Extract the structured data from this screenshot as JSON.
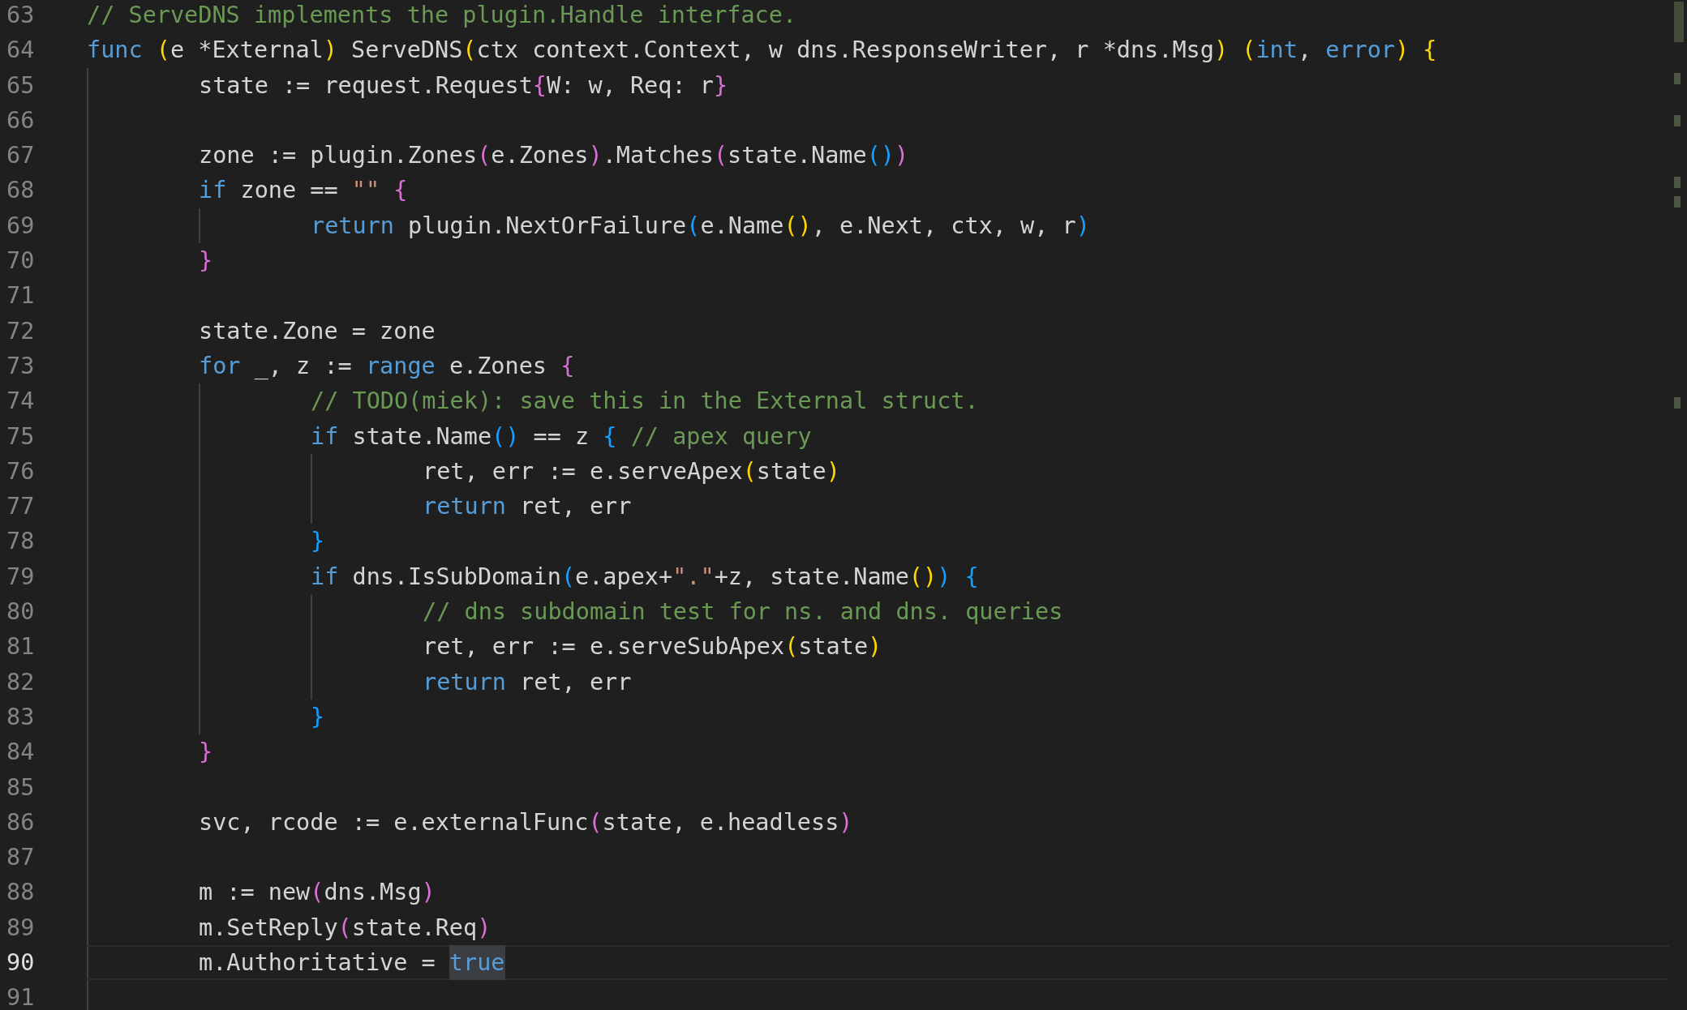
{
  "editor": {
    "lines": [
      {
        "number": "63",
        "current": false,
        "tokens": [
          {
            "text": "// ServeDNS implements the plugin.Handle interface.",
            "kind": "comment"
          }
        ]
      },
      {
        "number": "64",
        "current": false,
        "tokens": [
          {
            "text": "func",
            "kind": "keyword"
          },
          {
            "text": " (",
            "kind": "bracket1"
          },
          {
            "text": "e *External",
            "kind": "plain"
          },
          {
            "text": ")",
            "kind": "bracket1"
          },
          {
            "text": " ServeDNS",
            "kind": "plain"
          },
          {
            "text": "(",
            "kind": "bracket1"
          },
          {
            "text": "ctx context.Context, w dns.ResponseWriter, r *dns.Msg",
            "kind": "plain"
          },
          {
            "text": ")",
            "kind": "bracket1"
          },
          {
            "text": " (",
            "kind": "bracket1"
          },
          {
            "text": "int",
            "kind": "keyword"
          },
          {
            "text": ", ",
            "kind": "plain"
          },
          {
            "text": "error",
            "kind": "keyword"
          },
          {
            "text": ")",
            "kind": "bracket1"
          },
          {
            "text": " {",
            "kind": "bracket1"
          }
        ],
        "children": [
          {
            "number": "65",
            "current": false,
            "tokens": [
              {
                "text": "state := request.Request",
                "kind": "plain"
              },
              {
                "text": "{",
                "kind": "bracket2"
              },
              {
                "text": "W: w, Req: r",
                "kind": "plain"
              },
              {
                "text": "}",
                "kind": "bracket2"
              }
            ]
          },
          {
            "number": "66",
            "current": false
          },
          {
            "number": "67",
            "current": false,
            "tokens": [
              {
                "text": "zone := plugin.Zones",
                "kind": "plain"
              },
              {
                "text": "(",
                "kind": "bracket2"
              },
              {
                "text": "e.Zones",
                "kind": "plain"
              },
              {
                "text": ")",
                "kind": "bracket2"
              },
              {
                "text": ".Matches",
                "kind": "plain"
              },
              {
                "text": "(",
                "kind": "bracket2"
              },
              {
                "text": "state.Name",
                "kind": "plain"
              },
              {
                "text": "()",
                "kind": "bracket3"
              },
              {
                "text": ")",
                "kind": "bracket2"
              }
            ]
          },
          {
            "number": "68",
            "current": false,
            "tokens": [
              {
                "text": "if",
                "kind": "keyword"
              },
              {
                "text": " zone == ",
                "kind": "plain"
              },
              {
                "text": "\"\"",
                "kind": "string"
              },
              {
                "text": " {",
                "kind": "bracket2"
              }
            ],
            "children": [
              {
                "number": "69",
                "current": false,
                "tokens": [
                  {
                    "text": "return",
                    "kind": "keyword"
                  },
                  {
                    "text": " plugin.NextOrFailure",
                    "kind": "plain"
                  },
                  {
                    "text": "(",
                    "kind": "bracket3"
                  },
                  {
                    "text": "e.Name",
                    "kind": "plain"
                  },
                  {
                    "text": "()",
                    "kind": "bracket1"
                  },
                  {
                    "text": ", e.Next, ctx, w, r",
                    "kind": "plain"
                  },
                  {
                    "text": ")",
                    "kind": "bracket3"
                  }
                ]
              }
            ]
          },
          {
            "number": "70",
            "current": false,
            "tokens": [
              {
                "text": "}",
                "kind": "bracket2"
              }
            ]
          },
          {
            "number": "71",
            "current": false
          },
          {
            "number": "72",
            "current": false,
            "tokens": [
              {
                "text": "state.Zone = zone",
                "kind": "plain"
              }
            ]
          },
          {
            "number": "73",
            "current": false,
            "tokens": [
              {
                "text": "for",
                "kind": "keyword"
              },
              {
                "text": " _, z := ",
                "kind": "plain"
              },
              {
                "text": "range",
                "kind": "keyword"
              },
              {
                "text": " e.Zones",
                "kind": "plain"
              },
              {
                "text": " {",
                "kind": "bracket2"
              }
            ],
            "children": [
              {
                "number": "74",
                "current": false,
                "tokens": [
                  {
                    "text": "// TODO(miek): save this in the External struct.",
                    "kind": "comment"
                  }
                ]
              },
              {
                "number": "75",
                "current": false,
                "tokens": [
                  {
                    "text": "if",
                    "kind": "keyword"
                  },
                  {
                    "text": " state.Name",
                    "kind": "plain"
                  },
                  {
                    "text": "()",
                    "kind": "bracket3"
                  },
                  {
                    "text": " == z ",
                    "kind": "plain"
                  },
                  {
                    "text": "{",
                    "kind": "bracket3"
                  },
                  {
                    "text": " // apex query",
                    "kind": "comment"
                  }
                ],
                "children": [
                  {
                    "number": "76",
                    "current": false,
                    "tokens": [
                      {
                        "text": "ret, err := e.serveApex",
                        "kind": "plain"
                      },
                      {
                        "text": "(",
                        "kind": "bracket1"
                      },
                      {
                        "text": "state",
                        "kind": "plain"
                      },
                      {
                        "text": ")",
                        "kind": "bracket1"
                      }
                    ]
                  },
                  {
                    "number": "77",
                    "current": false,
                    "tokens": [
                      {
                        "text": "return",
                        "kind": "keyword"
                      },
                      {
                        "text": " ret, err",
                        "kind": "plain"
                      }
                    ]
                  }
                ]
              },
              {
                "number": "78",
                "current": false,
                "tokens": [
                  {
                    "text": "}",
                    "kind": "bracket3"
                  }
                ]
              },
              {
                "number": "79",
                "current": false,
                "tokens": [
                  {
                    "text": "if",
                    "kind": "keyword"
                  },
                  {
                    "text": " dns.IsSubDomain",
                    "kind": "plain"
                  },
                  {
                    "text": "(",
                    "kind": "bracket3"
                  },
                  {
                    "text": "e.apex+",
                    "kind": "plain"
                  },
                  {
                    "text": "\".\"",
                    "kind": "string"
                  },
                  {
                    "text": "+z, state.Name",
                    "kind": "plain"
                  },
                  {
                    "text": "()",
                    "kind": "bracket1"
                  },
                  {
                    "text": ")",
                    "kind": "bracket3"
                  },
                  {
                    "text": " {",
                    "kind": "bracket3"
                  }
                ],
                "children": [
                  {
                    "number": "80",
                    "current": false,
                    "tokens": [
                      {
                        "text": "// dns subdomain test for ns. and dns. queries",
                        "kind": "comment"
                      }
                    ]
                  },
                  {
                    "number": "81",
                    "current": false,
                    "tokens": [
                      {
                        "text": "ret, err := e.serveSubApex",
                        "kind": "plain"
                      },
                      {
                        "text": "(",
                        "kind": "bracket1"
                      },
                      {
                        "text": "state",
                        "kind": "plain"
                      },
                      {
                        "text": ")",
                        "kind": "bracket1"
                      }
                    ]
                  },
                  {
                    "number": "82",
                    "current": false,
                    "tokens": [
                      {
                        "text": "return",
                        "kind": "keyword"
                      },
                      {
                        "text": " ret, err",
                        "kind": "plain"
                      }
                    ]
                  }
                ]
              },
              {
                "number": "83",
                "current": false,
                "tokens": [
                  {
                    "text": "}",
                    "kind": "bracket3"
                  }
                ]
              }
            ]
          },
          {
            "number": "84",
            "current": false,
            "tokens": [
              {
                "text": "}",
                "kind": "bracket2"
              }
            ]
          },
          {
            "number": "85",
            "current": false
          },
          {
            "number": "86",
            "current": false,
            "tokens": [
              {
                "text": "svc, rcode := e.externalFunc",
                "kind": "plain"
              },
              {
                "text": "(",
                "kind": "bracket2"
              },
              {
                "text": "state, e.headless",
                "kind": "plain"
              },
              {
                "text": ")",
                "kind": "bracket2"
              }
            ]
          },
          {
            "number": "87",
            "current": false
          },
          {
            "number": "88",
            "current": false,
            "tokens": [
              {
                "text": "m := new",
                "kind": "plain"
              },
              {
                "text": "(",
                "kind": "bracket2"
              },
              {
                "text": "dns.Msg",
                "kind": "plain"
              },
              {
                "text": ")",
                "kind": "bracket2"
              }
            ]
          },
          {
            "number": "89",
            "current": false,
            "tokens": [
              {
                "text": "m.SetReply",
                "kind": "plain"
              },
              {
                "text": "(",
                "kind": "bracket2"
              },
              {
                "text": "state.Req",
                "kind": "plain"
              },
              {
                "text": ")",
                "kind": "bracket2"
              }
            ]
          },
          {
            "number": "90",
            "current": true,
            "tokens": [
              {
                "text": "m.Authoritative = ",
                "kind": "plain"
              },
              {
                "text": "true",
                "kind": "match"
              }
            ]
          },
          {
            "number": "91",
            "current": false
          }
        ]
      }
    ]
  }
}
